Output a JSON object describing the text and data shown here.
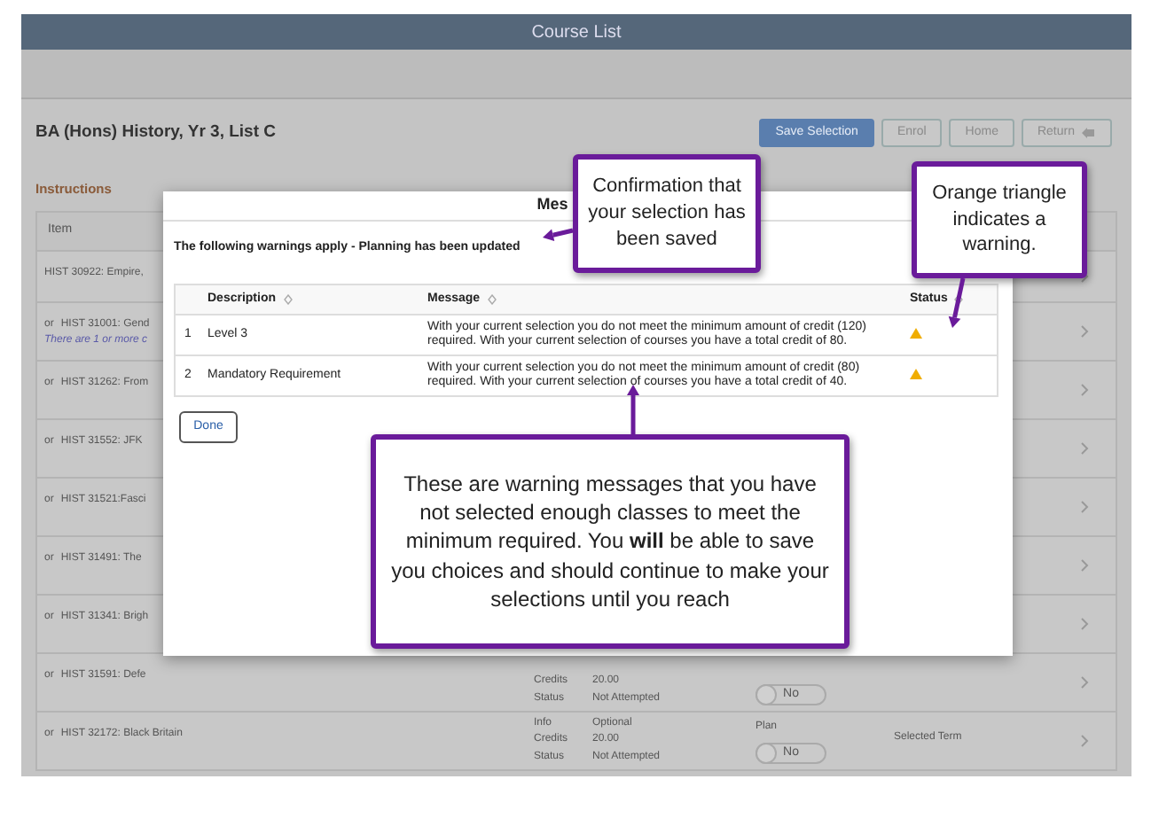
{
  "window": {
    "title": "Course List"
  },
  "page": {
    "title": "BA (Hons) History, Yr 3, List C",
    "instructions": "Instructions",
    "buttons": [
      {
        "label": "Save Selection",
        "kind": "primary"
      },
      {
        "label": "Enrol",
        "kind": "outline"
      },
      {
        "label": "Home",
        "kind": "outline"
      },
      {
        "label": "Return",
        "kind": "return"
      }
    ]
  },
  "table": {
    "columns": [
      "Item"
    ],
    "rows": [
      {
        "item": "HIST 30922: Empire,"
      },
      {
        "prefix": "or",
        "item": "HIST 31001: Gend",
        "note": "There are 1 or more c"
      },
      {
        "prefix": "or",
        "item": "HIST 31262: From"
      },
      {
        "prefix": "or",
        "item": "HIST 31552: JFK"
      },
      {
        "prefix": "or",
        "item": "HIST 31521:Fasci"
      },
      {
        "prefix": "or",
        "item": "HIST 31491: The"
      },
      {
        "prefix": "or",
        "item": "HIST 31341: Brigh"
      },
      {
        "prefix": "or",
        "item": "HIST 31591: Defe",
        "details": [
          {
            "label": "Credits",
            "value": "20.00"
          },
          {
            "label": "Status",
            "value": "Not Attempted"
          }
        ],
        "toggle": {
          "label": "No",
          "on": false
        }
      },
      {
        "prefix": "or",
        "item": "HIST 32172: Black Britain",
        "details": [
          {
            "label": "Info",
            "value": "Optional"
          },
          {
            "label": "Credits",
            "value": "20.00"
          },
          {
            "label": "Status",
            "value": "Not Attempted"
          }
        ],
        "plan_label": "Plan",
        "toggle": {
          "label": "No",
          "on": false
        },
        "term": "Selected Term"
      }
    ]
  },
  "modal": {
    "title": "Mes",
    "intro": "The following warnings apply - Planning has been updated",
    "columns": [
      "Description",
      "Message",
      "Status"
    ],
    "rows": [
      {
        "number": "1",
        "description": "Level 3",
        "message": "With your current selection you do not meet the minimum amount of credit (120) required. With your current selection of courses you have a total credit of 80.",
        "warning": true
      },
      {
        "number": "2",
        "description": "Mandatory Requirement",
        "message": "With your current selection you do not meet the minimum amount of credit (80) required. With your current selection of courses you have a total credit of 40.",
        "warning": true
      }
    ],
    "done_button": "Done"
  },
  "callouts": [
    {
      "text": "Confirmation that your selection has been saved"
    },
    {
      "text": "Orange triangle indicates a warning."
    },
    {
      "text": "These are warning messages that you have not selected enough classes to meet the minimum required. You **will** be able to save you choices and should continue to make your selections until you reach"
    }
  ]
}
